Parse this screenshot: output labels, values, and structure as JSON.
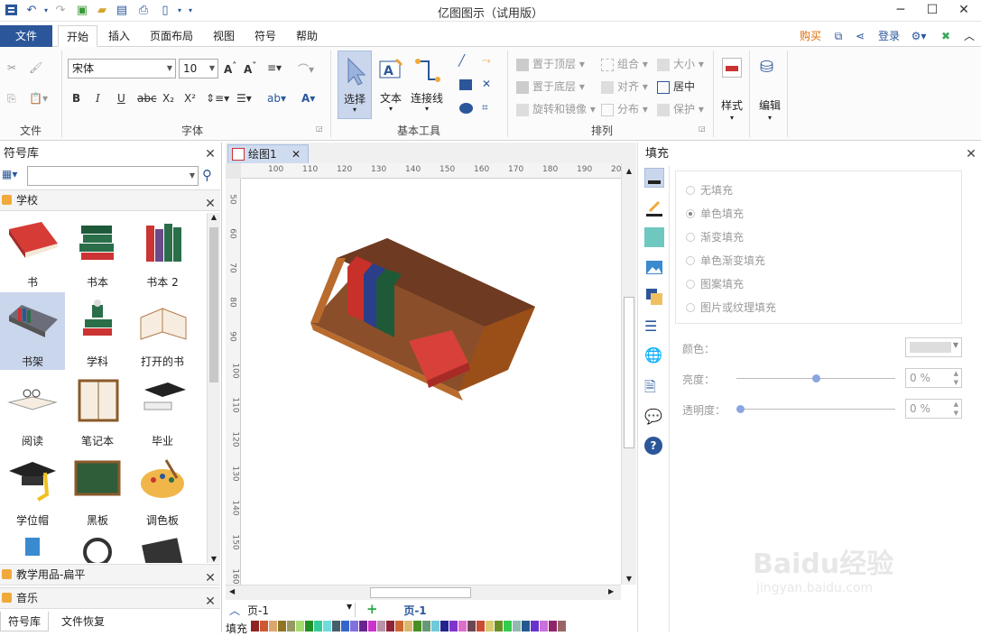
{
  "app": {
    "title": "亿图图示（试用版）"
  },
  "ribbon_tabs": [
    "文件",
    "开始",
    "插入",
    "页面布局",
    "视图",
    "符号",
    "帮助"
  ],
  "account": {
    "buy": "购买",
    "login": "登录"
  },
  "font": {
    "name": "宋体",
    "size": "10"
  },
  "groups": {
    "file": "文件",
    "font": "字体",
    "basic_tools": "基本工具",
    "arrange": "排列"
  },
  "tools": {
    "select": "选择",
    "text": "文本",
    "connector": "连接线",
    "style": "样式",
    "edit": "编辑"
  },
  "arrange": {
    "bring_front": "置于顶层",
    "send_back": "置于底层",
    "rotate": "旋转和镜像",
    "group": "组合",
    "align": "对齐",
    "distribute": "分布",
    "size": "大小",
    "center": "居中",
    "protect": "保护"
  },
  "library": {
    "title": "符号库",
    "category": "学校",
    "category2": "教学用品-扁平",
    "category3": "音乐",
    "tab_lib": "符号库",
    "tab_recover": "文件恢复"
  },
  "symbols": [
    "书",
    "书本",
    "书本 2",
    "书架",
    "学科",
    "打开的书",
    "阅读",
    "笔记本",
    "毕业",
    "学位帽",
    "黑板",
    "调色板"
  ],
  "document": {
    "tab": "绘图1"
  },
  "ruler_h": [
    "100",
    "110",
    "120",
    "130",
    "140",
    "150",
    "160",
    "170",
    "180",
    "190",
    "200"
  ],
  "ruler_v": [
    "50",
    "60",
    "70",
    "80",
    "90",
    "100",
    "110",
    "120",
    "130",
    "140",
    "150",
    "160"
  ],
  "fill_panel": {
    "title": "填充",
    "options": [
      "无填充",
      "单色填充",
      "渐变填充",
      "单色渐变填充",
      "图案填充",
      "图片或纹理填充"
    ],
    "color_label": "颜色：",
    "brightness_label": "亮度：",
    "brightness_value": "0 %",
    "transparency_label": "透明度：",
    "transparency_value": "0 %",
    "brightness": 0.5,
    "transparency": 0
  },
  "status": {
    "page_select": "页-1",
    "page_tab": "页-1",
    "fill_label": "填充"
  },
  "watermark": {
    "brand": "Baidu经验",
    "url": "jingyan.baidu.com"
  },
  "colors": {
    "accent": "#2b579a",
    "file_tab": "#2b579a",
    "buy": "#e06c00"
  }
}
